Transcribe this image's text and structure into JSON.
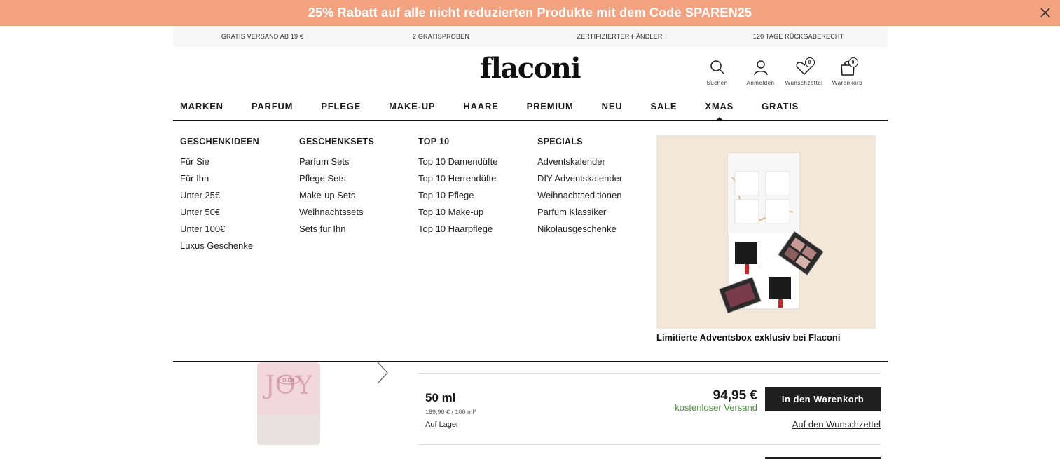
{
  "promo_bar": {
    "text": "25% Rabatt auf alle nicht reduzierten Produkte mit dem Code SPAREN25",
    "close_icon": "close-icon",
    "background": "#f4a381"
  },
  "usp_bar": {
    "items": [
      "GRATIS VERSAND AB 19 €",
      "2 GRATISPROBEN",
      "ZERTIFIZIERTER HÄNDLER",
      "120 TAGE RÜCKGABERECHT"
    ]
  },
  "header": {
    "logo": "flaconi",
    "icons": [
      {
        "icon": "search-icon",
        "label": "Suchen"
      },
      {
        "icon": "user-icon",
        "label": "Anmelden"
      },
      {
        "icon": "heart-icon",
        "label": "Wunschzettel",
        "count": "0"
      },
      {
        "icon": "bag-icon",
        "label": "Warenkorb",
        "count": "0"
      }
    ]
  },
  "nav": {
    "items": [
      "MARKEN",
      "PARFUM",
      "PFLEGE",
      "MAKE-UP",
      "HAARE",
      "PREMIUM",
      "NEU",
      "SALE",
      "XMAS",
      "GRATIS"
    ],
    "active": "XMAS"
  },
  "mega_menu": {
    "columns": [
      {
        "heading": "GESCHENKIDEEN",
        "links": [
          "Für Sie",
          "Für Ihn",
          "Unter 25€",
          "Unter 50€",
          "Unter 100€",
          "Luxus Geschenke"
        ]
      },
      {
        "heading": "GESCHENKSETS",
        "links": [
          "Parfum Sets",
          "Pflege Sets",
          "Make-up Sets",
          "Weihnachtssets",
          "Sets für Ihn"
        ]
      },
      {
        "heading": "TOP 10",
        "links": [
          "Top 10 Damendüfte",
          "Top 10 Herrendüfte",
          "Top 10 Pflege",
          "Top 10 Make-up",
          "Top 10 Haarpflege"
        ]
      },
      {
        "heading": "SPECIALS",
        "links": [
          "Adventskalender",
          "DIY Adventskalender",
          "Weihnachtseditionen",
          "Parfum Klassiker",
          "Nikolausgeschenke"
        ]
      }
    ],
    "promo": {
      "caption": "Limitierte Adventsbox exklusiv bei Flaconi",
      "background": "#f3e7d8"
    }
  },
  "product": {
    "image_icon": "perfume-bottle-image",
    "image_text": "JOY",
    "bottle_label": "DIOR",
    "carousel_icon": "chevron-right-icon",
    "variant": {
      "size": "50 ml",
      "unit_price": "189,90 € / 100 ml*",
      "stock": "Auf Lager",
      "price": "94,95 €",
      "shipping": "kostenloser Versand",
      "cart_label": "In den Warenkorb",
      "wishlist_label": "Auf den Wunschzettel"
    },
    "shipping_color": "#4a8f3a"
  }
}
